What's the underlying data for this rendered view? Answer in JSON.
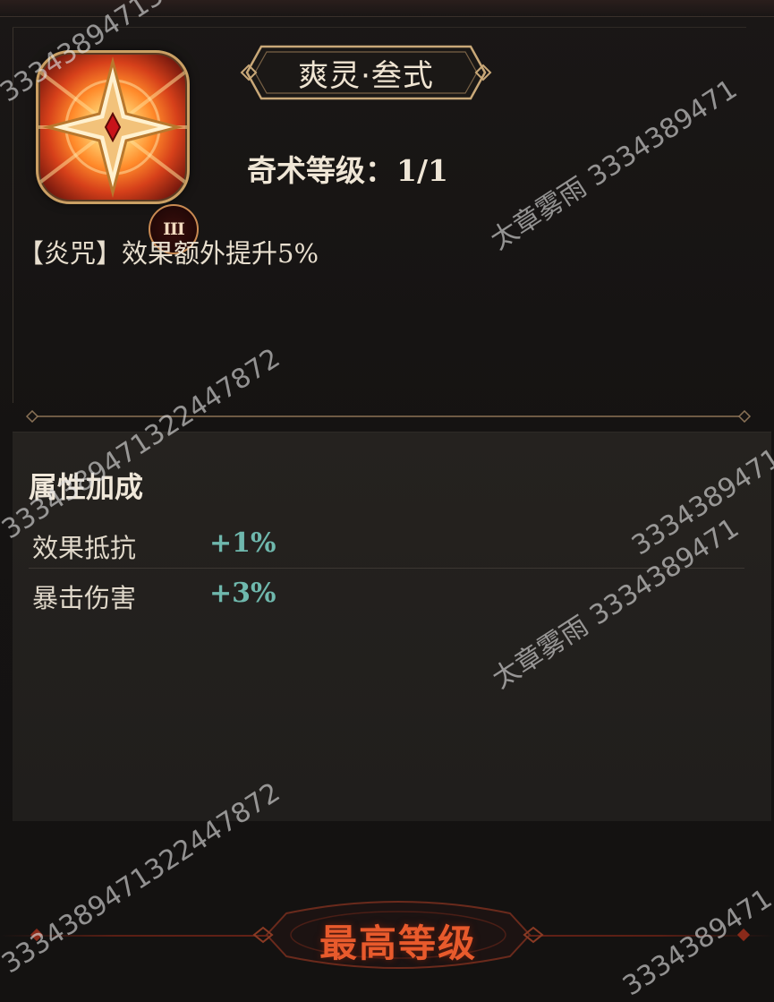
{
  "skill": {
    "title": "爽灵·叁式",
    "tier_badge": "III",
    "level_label": "奇术等级：",
    "level_value": "1/1",
    "effect": "【炎咒】效果额外提升5%",
    "icon": "four-point-star-flame-icon"
  },
  "attributes": {
    "heading": "属性加成",
    "rows": [
      {
        "name": "效果抵抗",
        "value": "+1%"
      },
      {
        "name": "暴击伤害",
        "value": "+3%"
      }
    ]
  },
  "footer": {
    "button_label": "最高等级"
  },
  "watermarks": {
    "a": "3334389471322447872",
    "b": "太章雾雨 3334389471",
    "c": "3334389471322447872",
    "d": "太章雾雨 3334389471",
    "e": "3334389471322447872",
    "f": "3334389471",
    "g": "3334389471"
  },
  "colors": {
    "attr_value": "#6fb8ad",
    "button_text": "#e85a2c",
    "panel_bg": "#221f1d"
  }
}
